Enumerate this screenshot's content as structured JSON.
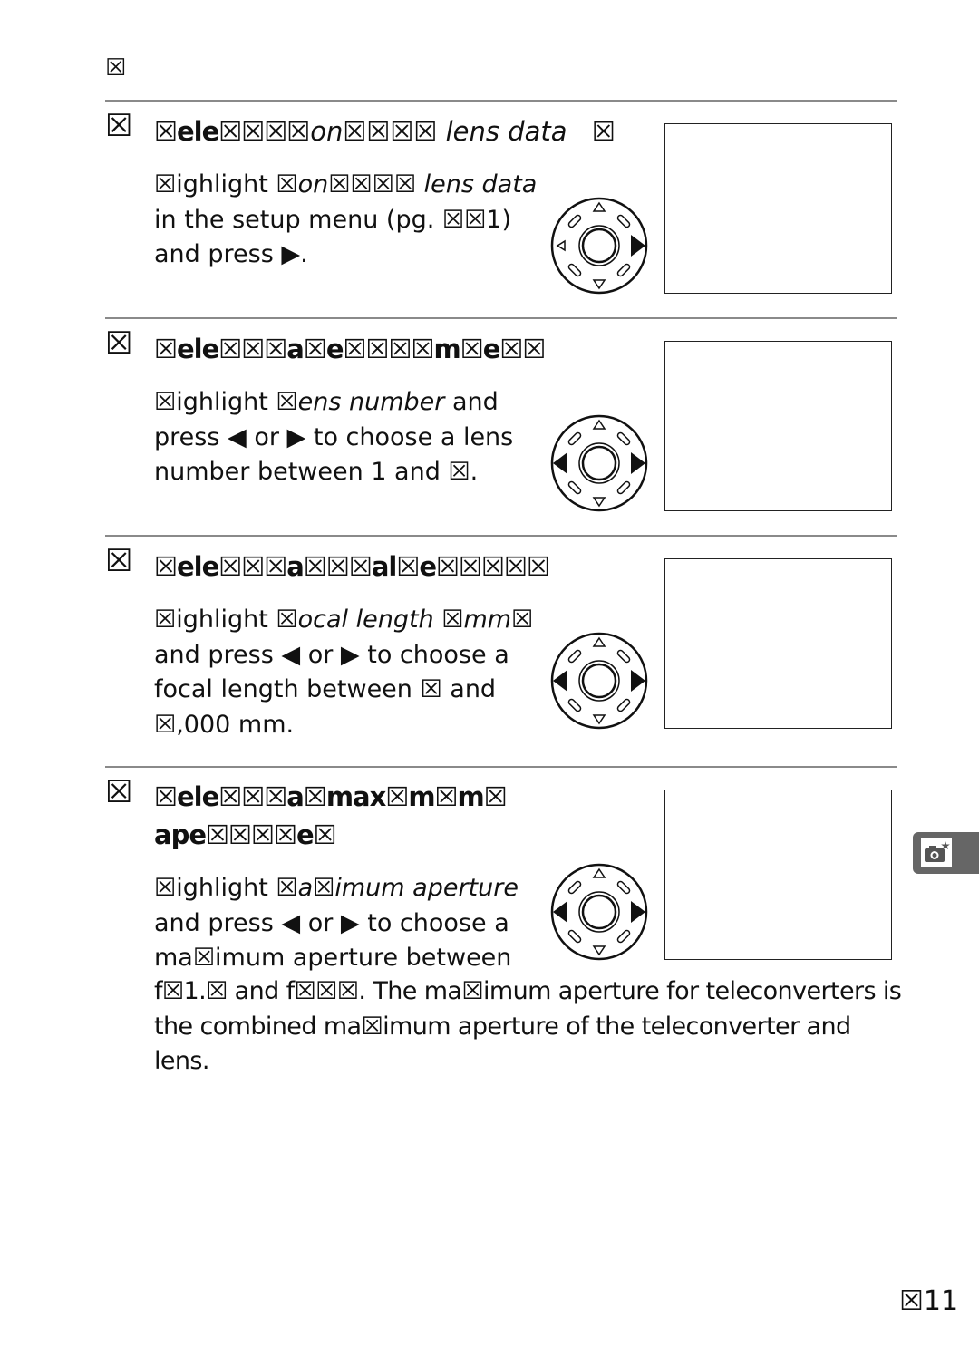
{
  "page": {
    "top_mark": "☒",
    "page_number": "☒11",
    "side_tab_icon": "camera-star-icon"
  },
  "steps": [
    {
      "number": "☒",
      "title_bold": "☒ele☒☒☒",
      "title_italic": "☒on☒☒☒☒ lens data",
      "title_suffix": "☒",
      "body": [
        {
          "t": "☒ighlight ",
          "i": false
        },
        {
          "t": "☒on☒☒☒☒ lens data",
          "i": true
        },
        {
          "t": " in the setup menu (pg. ☒☒1) and press ▶.",
          "i": false
        }
      ],
      "dial_active": [
        "right"
      ]
    },
    {
      "number": "☒",
      "title_bold": "☒ele☒☒☒a☒e☒☒☒☒m☒e☒☒",
      "body": [
        {
          "t": "☒ighlight ",
          "i": false
        },
        {
          "t": "☒ens number",
          "i": true
        },
        {
          "t": "    and press ◀ or ▶ to choose a lens number between 1 and ☒.",
          "i": false
        }
      ],
      "dial_active": [
        "left",
        "right"
      ]
    },
    {
      "number": "☒",
      "title_bold": "☒ele☒☒☒a☒☒☒al☒e☒☒☒☒☒",
      "body": [
        {
          "t": "☒ighlight ",
          "i": false
        },
        {
          "t": "☒ocal length ☒mm☒",
          "i": true
        },
        {
          "t": " and press ◀ or ▶ to choose a focal length between ☒ and ☒,000 mm.",
          "i": false
        }
      ],
      "dial_active": [
        "left",
        "right"
      ]
    },
    {
      "number": "☒",
      "title_bold": "☒ele☒☒☒a☒max☒m☒m☒ ape☒☒☒☒e☒",
      "body": [
        {
          "t": "☒ighlight ",
          "i": false
        },
        {
          "t": "☒a☒imum aperture",
          "i": true
        },
        {
          "t": " and press ◀ or ▶ to choose a ma☒imum aperture between",
          "i": false
        }
      ],
      "body_continued": "f☒1.☒ and f☒☒☒. The ma☒imum aperture for teleconverters is the combined ma☒imum aperture of the teleconverter and lens.",
      "dial_active": [
        "left",
        "right"
      ]
    }
  ]
}
